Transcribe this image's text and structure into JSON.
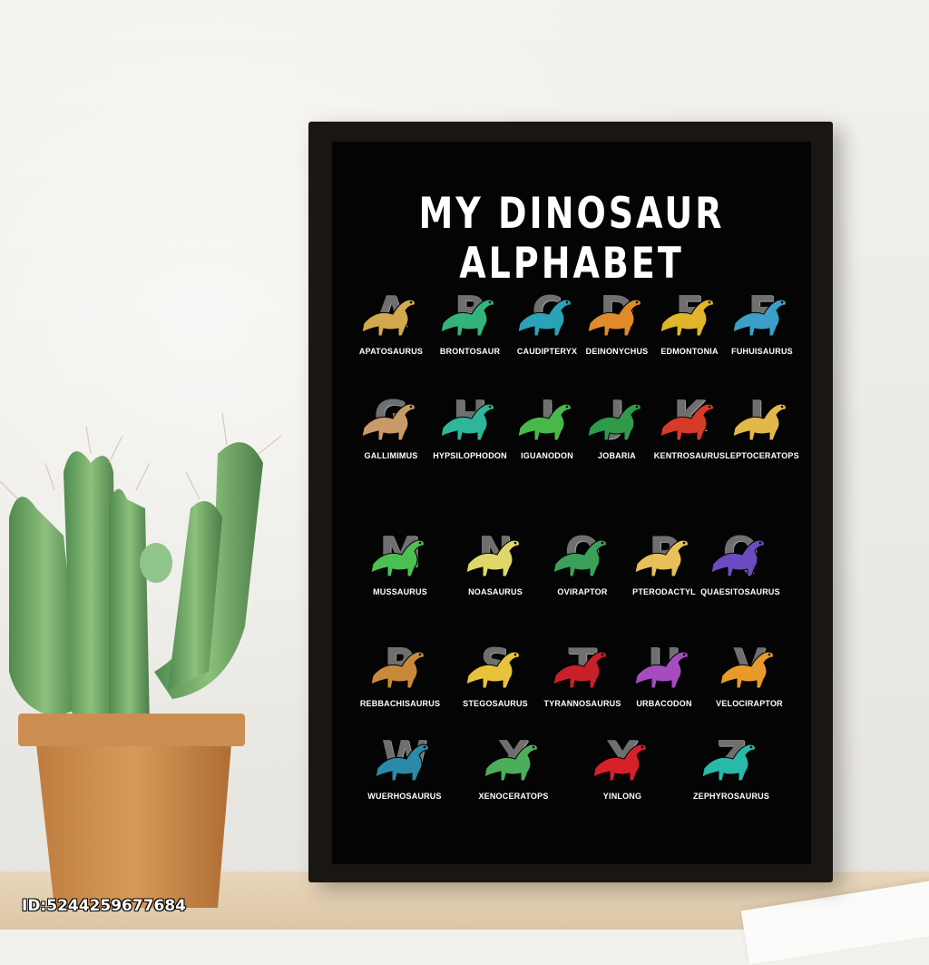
{
  "poster": {
    "title": "MY DINOSAUR ALPHABET",
    "entries": [
      {
        "letter": "A",
        "name": "APATOSAURUS",
        "color": "#d2a94e"
      },
      {
        "letter": "B",
        "name": "BRONTOSAUR",
        "color": "#34b37a"
      },
      {
        "letter": "C",
        "name": "CAUDIPTERYX",
        "color": "#2aa3b8"
      },
      {
        "letter": "D",
        "name": "DEINONYCHUS",
        "color": "#e08a2a"
      },
      {
        "letter": "E",
        "name": "EDMONTONIA",
        "color": "#e0b52a"
      },
      {
        "letter": "F",
        "name": "FUHUISAURUS",
        "color": "#3aa0c8"
      },
      {
        "letter": "G",
        "name": "GALLIMIMUS",
        "color": "#c89a68"
      },
      {
        "letter": "H",
        "name": "HYPSILOPHODON",
        "color": "#2fb59a"
      },
      {
        "letter": "I",
        "name": "IGUANODON",
        "color": "#48b84a"
      },
      {
        "letter": "J",
        "name": "JOBARIA",
        "color": "#2f9a4a"
      },
      {
        "letter": "K",
        "name": "KENTROSAURUS",
        "color": "#d83a2a"
      },
      {
        "letter": "L",
        "name": "LEPTOCERATOPS",
        "color": "#e2b84a"
      },
      {
        "letter": "M",
        "name": "MUSSAURUS",
        "color": "#4cbf52"
      },
      {
        "letter": "N",
        "name": "NOASAURUS",
        "color": "#e0d66a"
      },
      {
        "letter": "O",
        "name": "OVIRAPTOR",
        "color": "#3aa05a"
      },
      {
        "letter": "P",
        "name": "PTERODACTYL",
        "color": "#e8c05a"
      },
      {
        "letter": "Q",
        "name": "QUAESITOSAURUS",
        "color": "#6a4cc0"
      },
      {
        "letter": "R",
        "name": "REBBACHISAURUS",
        "color": "#c88a3a"
      },
      {
        "letter": "S",
        "name": "STEGOSAURUS",
        "color": "#e8c23a"
      },
      {
        "letter": "T",
        "name": "TYRANNOSAURUS",
        "color": "#c8202a"
      },
      {
        "letter": "U",
        "name": "URBACODON",
        "color": "#a44cc0"
      },
      {
        "letter": "V",
        "name": "VELOCIRAPTOR",
        "color": "#e89a2a"
      },
      {
        "letter": "W",
        "name": "WUERHOSAURUS",
        "color": "#2a8aa8"
      },
      {
        "letter": "X",
        "name": "XENOCERATOPS",
        "color": "#4cae5a"
      },
      {
        "letter": "Y",
        "name": "YINLONG",
        "color": "#d8202a"
      },
      {
        "letter": "Z",
        "name": "ZEPHYROSAURUS",
        "color": "#2ab8a8"
      }
    ]
  },
  "watermark": "ID:5244259677684",
  "colors": {
    "frame": "#1a1612",
    "poster_bg": "#040404",
    "letter": "#6f6f6f",
    "cactus": "#5f9a5a",
    "pot": "#c98a4a"
  }
}
